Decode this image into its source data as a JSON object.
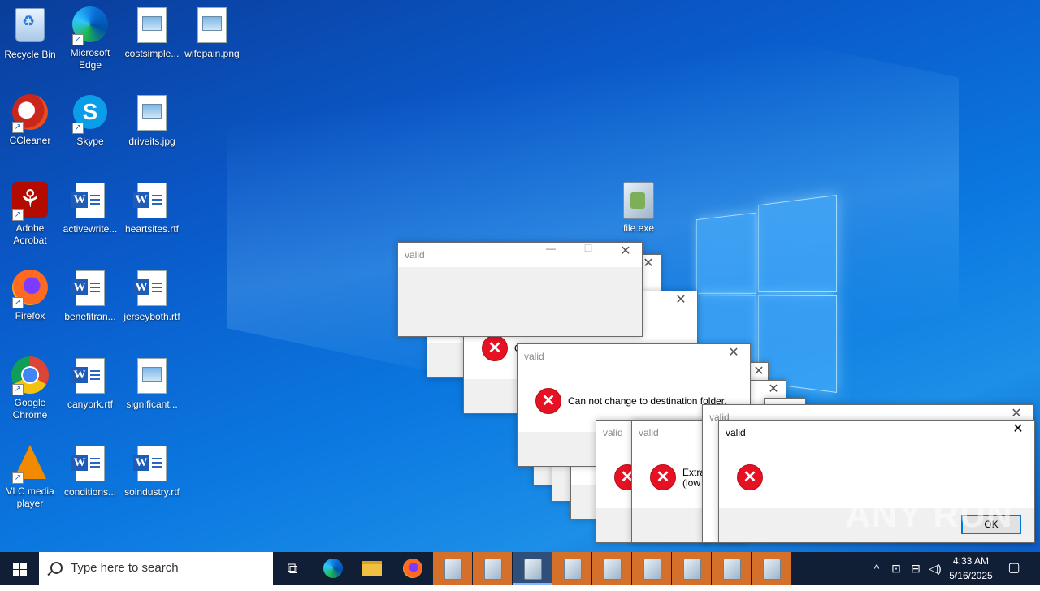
{
  "desktop": {
    "icons": [
      {
        "label": "Recycle Bin"
      },
      {
        "label": "Microsoft Edge"
      },
      {
        "label": "costsimple..."
      },
      {
        "label": "wifepain.png"
      },
      {
        "label": "CCleaner"
      },
      {
        "label": "Skype"
      },
      {
        "label": "driveits.jpg"
      },
      {
        "label": "Adobe Acrobat"
      },
      {
        "label": "activewrite..."
      },
      {
        "label": "heartsites.rtf"
      },
      {
        "label": "Firefox"
      },
      {
        "label": "benefitran..."
      },
      {
        "label": "jerseyboth.rtf"
      },
      {
        "label": "Google Chrome"
      },
      {
        "label": "canyork.rtf"
      },
      {
        "label": "significant..."
      },
      {
        "label": "VLC media player"
      },
      {
        "label": "conditions..."
      },
      {
        "label": "soindustry.rtf"
      },
      {
        "label": "file.exe"
      }
    ]
  },
  "dialogs": {
    "title": "valid",
    "message": "Can not change to destination folder.",
    "partial_message_1": "Extra",
    "partial_message_2": "(low",
    "partial_c": "C",
    "ok_label": "OK",
    "close_glyph": "✕",
    "min_glyph": "—",
    "max_glyph": "☐",
    "error_glyph": "✕"
  },
  "taskbar": {
    "search_placeholder": "Type here to search",
    "time": "4:33 AM",
    "date": "5/16/2025",
    "task_view_glyph": "⧉",
    "tray_chevron": "^",
    "notification_glyph": "▢"
  },
  "watermark": "ANY RUN",
  "colors": {
    "taskbar": "#101e36",
    "running_app": "#d4702a",
    "error": "#e81123",
    "accent": "#0078d7"
  }
}
